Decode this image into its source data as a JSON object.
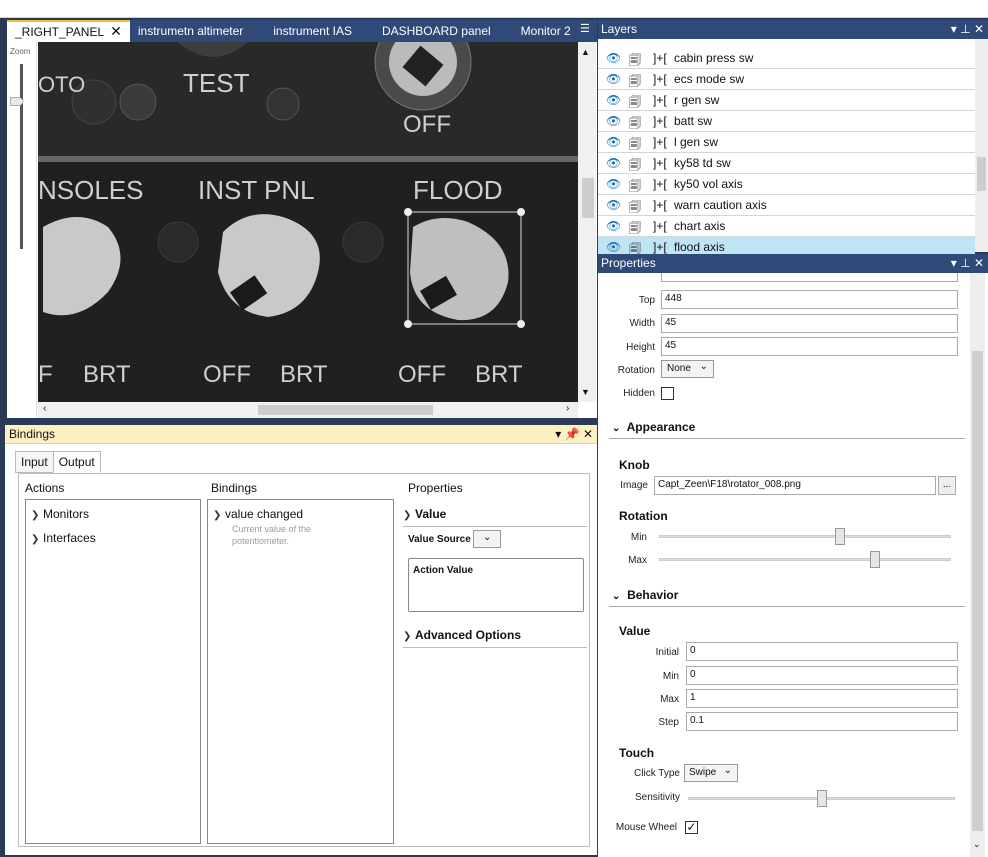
{
  "document_tabs": [
    {
      "label": "_RIGHT_PANEL",
      "active": true
    },
    {
      "label": "instrumetn altimeter"
    },
    {
      "label": "instrument IAS"
    },
    {
      "label": "DASHBOARD panel"
    },
    {
      "label": "Monitor 2"
    }
  ],
  "zoom_label": "Zoom",
  "panel_image": {
    "labels": [
      "TEST",
      "OFF",
      "NSOLES",
      "INST PNL",
      "FLOOD",
      "F",
      "BRT",
      "OFF",
      "BRT",
      "OFF",
      "BRT",
      "OTO"
    ]
  },
  "bindings": {
    "title": "Bindings",
    "tabs": [
      "Input",
      "Output"
    ],
    "actions_header": "Actions",
    "bindings_header": "Bindings",
    "properties_header": "Properties",
    "actions": [
      "Monitors",
      "Interfaces"
    ],
    "binding_item": {
      "title": "value changed",
      "desc": "Current value of the potentiometer."
    },
    "value_section": "Value",
    "value_source_label": "Value Source",
    "action_value_label": "Action Value",
    "advanced_options": "Advanced Options"
  },
  "layers": {
    "title": "Layers",
    "items": [
      "cabin press sw",
      "ecs mode sw",
      "r gen sw",
      "batt sw",
      "l gen sw",
      "ky58 td sw",
      "ky50 vol axis",
      "warn caution axis",
      "chart axis",
      "flood axis"
    ],
    "selected": "flood axis"
  },
  "properties": {
    "title": "Properties",
    "layout": {
      "top_label": "Top",
      "top": "448",
      "width_label": "Width",
      "width": "45",
      "height_label": "Height",
      "height": "45",
      "rotation_label": "Rotation",
      "rotation": "None",
      "hidden_label": "Hidden"
    },
    "appearance": "Appearance",
    "knob": "Knob",
    "image_label": "Image",
    "image": "Capt_Zeen\\F18\\rotator_008.png",
    "rotation_section": "Rotation",
    "min_label": "Min",
    "max_label": "Max",
    "rotation_min": 0.62,
    "rotation_max": 0.74,
    "behavior": "Behavior",
    "value_section": "Value",
    "initial_label": "Initial",
    "initial": "0",
    "vmin_label": "Min",
    "vmin": "0",
    "vmax_label": "Max",
    "vmax": "1",
    "step_label": "Step",
    "step": "0.1",
    "touch": "Touch",
    "click_type_label": "Click Type",
    "click_type": "Swipe",
    "sensitivity_label": "Sensitivity",
    "sensitivity": 0.5,
    "mouse_wheel_label": "Mouse Wheel",
    "mouse_wheel": true
  }
}
